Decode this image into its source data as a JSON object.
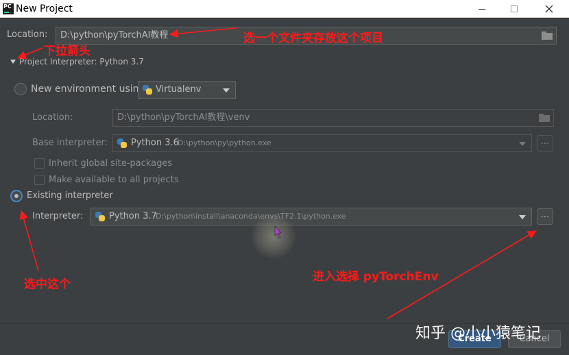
{
  "window": {
    "title": "New Project",
    "app_icon_text": "PC"
  },
  "location": {
    "label": "Location:",
    "value": "D:\\python\\pyTorchAI教程"
  },
  "interpreter_section": {
    "header": "Project Interpreter: Python 3.7"
  },
  "new_env": {
    "radio_label": "New environment using",
    "env_type": "Virtualenv",
    "location_label": "Location:",
    "location_value": "D:\\python\\pyTorchAI教程\\venv",
    "base_label": "Base interpreter:",
    "base_name": "Python 3.6",
    "base_path": "D:\\python\\py\\python.exe",
    "base_button": "...",
    "inherit_label": "Inherit global site-packages",
    "available_label": "Make available to all projects"
  },
  "existing": {
    "radio_label": "Existing interpreter",
    "interpreter_label": "Interpreter:",
    "interpreter_name": "Python 3.7",
    "interpreter_path": "D:\\python\\install\\anaconda\\envs\\TF2.1\\python.exe",
    "browse_button": "..."
  },
  "buttons": {
    "create": "Create",
    "cancel": "Cancel"
  },
  "annotations": {
    "folder_note": "选一个文件夹存放这个项目",
    "dropdown_note": "下拉箭头",
    "select_note": "选中这个",
    "choose_note": "进入选择 pyTorchEnv"
  },
  "watermark": "知乎 @小小猿笔记",
  "colors": {
    "background": "#3c3f41",
    "annotation_red": "#ff1a1a",
    "radio_focus": "#4a88c7",
    "primary_button": "#365880"
  }
}
